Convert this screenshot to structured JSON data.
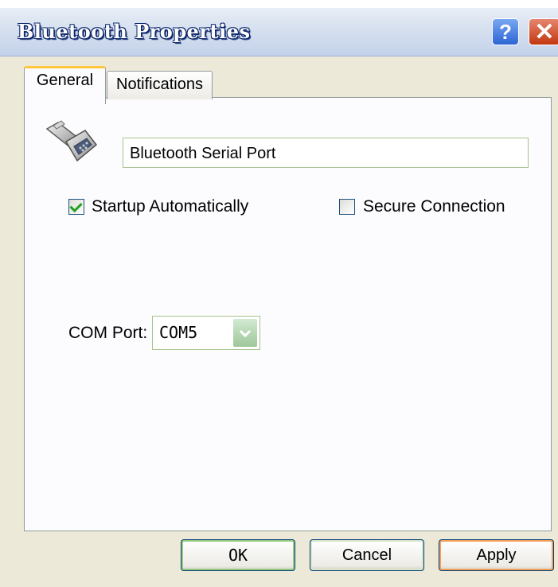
{
  "window": {
    "title": "Bluetooth Properties",
    "help_label": "?",
    "close_label": "✕"
  },
  "tabs": [
    {
      "label": "General",
      "active": true
    },
    {
      "label": "Notifications",
      "active": false
    }
  ],
  "general": {
    "icon": "serial-port-icon",
    "name_value": "Bluetooth Serial Port",
    "startup": {
      "label": "Startup Automatically",
      "checked": true
    },
    "secure": {
      "label": "Secure Connection",
      "checked": false
    },
    "com_port": {
      "label": "COM Port:",
      "value": "COM5"
    }
  },
  "buttons": {
    "ok": "OK",
    "cancel": "Cancel",
    "apply": "Apply"
  },
  "colors": {
    "title_text": "#ffffff",
    "active_tab_highlight": "#ffc83c",
    "checkmark": "#21a121",
    "close_button": "#c2360e",
    "help_button": "#2c65d4"
  }
}
